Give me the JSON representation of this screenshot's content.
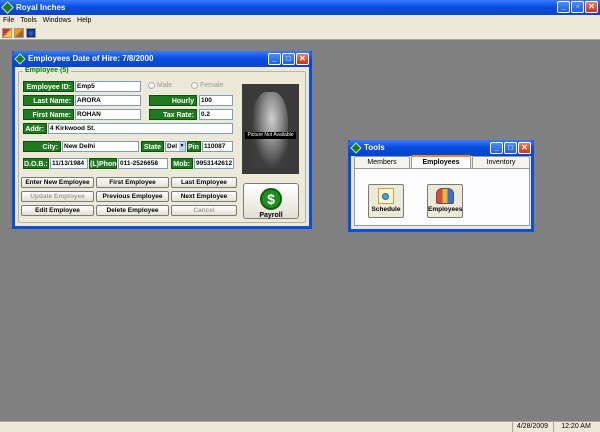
{
  "app": {
    "title": "Royal Inches",
    "menu": [
      "File",
      "Tools",
      "Windows",
      "Help"
    ],
    "toolbar_icons": [
      "toolbar-icon-1",
      "toolbar-icon-2",
      "toolbar-icon-3"
    ]
  },
  "employee_window": {
    "title": "Employees Date of Hire: 7/8/2000",
    "group": "Employee (5)",
    "labels": {
      "emp_id": "Employee ID:",
      "last_name": "Last Name:",
      "first_name": "First Name:",
      "addr": "Addr:",
      "city": "City:",
      "state": "State :",
      "pin": "Pin",
      "dob": "D.O.B.:",
      "phone": "(L)Phone",
      "mob": "Mob:",
      "hourly": "Hourly Wage:",
      "tax": "Tax Rate:"
    },
    "values": {
      "emp_id": "Emp5",
      "last_name": "ARORA",
      "first_name": "ROHAN",
      "addr": "4 Kirkwood St.",
      "city": "New Delhi",
      "state": "Del",
      "pin": "110087",
      "dob": "11/13/1984",
      "phone": "011-2526658",
      "mob": "9953142612",
      "hourly": "100",
      "tax": "0.2"
    },
    "gender": {
      "male": "Male",
      "female": "Female"
    },
    "photo_caption": "Picture Not Available",
    "buttons": {
      "enter_new": "Enter New Employee",
      "first": "First Employee",
      "last": "Last Employee",
      "update": "Update Employee",
      "previous": "Previous Employee",
      "next": "Next Employee",
      "edit": "Edit Employee",
      "delete": "Delete Employee",
      "cancel": "Cancel",
      "payroll": "Payroll",
      "payroll_symbol": "$"
    }
  },
  "tools_window": {
    "title": "Tools",
    "tabs": [
      "Members",
      "Employees",
      "Inventory"
    ],
    "active_tab": "Employees",
    "items": {
      "schedule": "Schedule",
      "employees": "Employees"
    }
  },
  "status": {
    "date": "4/28/2009",
    "time": "12:20 AM"
  },
  "colors": {
    "title_blue": "#0a4ee0",
    "label_green": "#1f7a1f",
    "legend_green": "#008000"
  }
}
